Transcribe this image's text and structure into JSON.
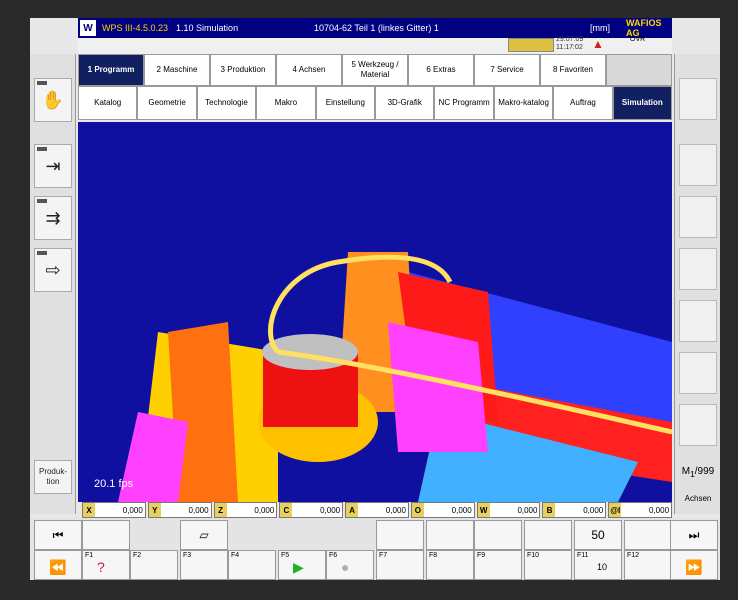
{
  "title": {
    "logo": "W",
    "version": "WPS III-4.5.0.23",
    "screen": "1.10 Simulation",
    "program": "10704-62   Teil 1 (linkes Gitter)   1",
    "unit": "[mm]",
    "brand": "WAFIOS AG"
  },
  "status": {
    "date": "29.07.09",
    "time": "11:17:02",
    "ovr": "OVR",
    "warning_icon": "warning-triangle-icon"
  },
  "main_menu": [
    "1 Programm",
    "2 Maschine",
    "3 Produktion",
    "4 Achsen",
    "5 Werkzeug / Material",
    "6 Extras",
    "7 Service",
    "8 Favoriten",
    ""
  ],
  "main_menu_active": 0,
  "sub_menu": [
    "Katalog",
    "Geometrie",
    "Technologie",
    "Makro",
    "Einstellung",
    "3D-Grafik",
    "NC Programm",
    "Makro-katalog",
    "Auftrag",
    "Simulation"
  ],
  "sub_menu_active": 9,
  "left_buttons": [
    {
      "icon": "hand-icon",
      "glyph": "✋"
    },
    {
      "icon": "step-into-icon",
      "glyph": "⇥"
    },
    {
      "icon": "step-block-icon",
      "glyph": "⇉"
    },
    {
      "icon": "step-arrow-icon",
      "glyph": "⇨"
    }
  ],
  "left_produktion": "Produk-tion",
  "right_labels": {
    "m": "M",
    "m_val": "1",
    "m_max": "999",
    "achsen": "Achsen"
  },
  "viewport": {
    "fps": "20.1 fps",
    "bg": "#1010a0"
  },
  "axes": [
    {
      "name": "X",
      "value": "0,000"
    },
    {
      "name": "Y",
      "value": "0,000"
    },
    {
      "name": "Z",
      "value": "0,000"
    },
    {
      "name": "C",
      "value": "0,000"
    },
    {
      "name": "A",
      "value": "0,000"
    },
    {
      "name": "O",
      "value": "0,000"
    },
    {
      "name": "W",
      "value": "0,000"
    },
    {
      "name": "B",
      "value": "0,000"
    },
    {
      "name": "@I",
      "value": "0,000"
    }
  ],
  "fkeys": [
    {
      "label": "F1",
      "icon": "help-icon",
      "glyph": "?"
    },
    {
      "label": "F2",
      "icon": "",
      "glyph": ""
    },
    {
      "label": "F3",
      "icon": "",
      "glyph": ""
    },
    {
      "label": "F4",
      "icon": "",
      "glyph": ""
    },
    {
      "label": "F5",
      "icon": "play-icon",
      "glyph": "▶"
    },
    {
      "label": "F6",
      "icon": "stop-icon",
      "glyph": "●"
    },
    {
      "label": "F7",
      "icon": "",
      "glyph": ""
    },
    {
      "label": "F8",
      "icon": "",
      "glyph": ""
    },
    {
      "label": "F9",
      "icon": "",
      "glyph": ""
    },
    {
      "label": "F10",
      "icon": "",
      "glyph": ""
    },
    {
      "label": "F11",
      "icon": "",
      "glyph": "10"
    },
    {
      "label": "F12",
      "icon": "",
      "glyph": ""
    }
  ],
  "top_keys": [
    {
      "icon": "skip-back-icon",
      "glyph": "⏮"
    },
    {
      "icon": "",
      "glyph": ""
    },
    {
      "icon": "cube-icon",
      "glyph": "▱"
    },
    {
      "icon": "",
      "glyph": ""
    },
    {
      "icon": "",
      "glyph": ""
    },
    {
      "icon": "",
      "glyph": ""
    },
    {
      "icon": "",
      "glyph": ""
    },
    {
      "icon": "",
      "glyph": ""
    },
    {
      "icon": "",
      "glyph": ""
    },
    {
      "icon": "",
      "glyph": ""
    },
    {
      "icon": "",
      "glyph": "50"
    },
    {
      "icon": "",
      "glyph": ""
    },
    {
      "icon": "skip-forward-icon",
      "glyph": "⏭"
    }
  ],
  "nav": {
    "rewind_glyph": "⏪",
    "forward_glyph": "⏩"
  }
}
